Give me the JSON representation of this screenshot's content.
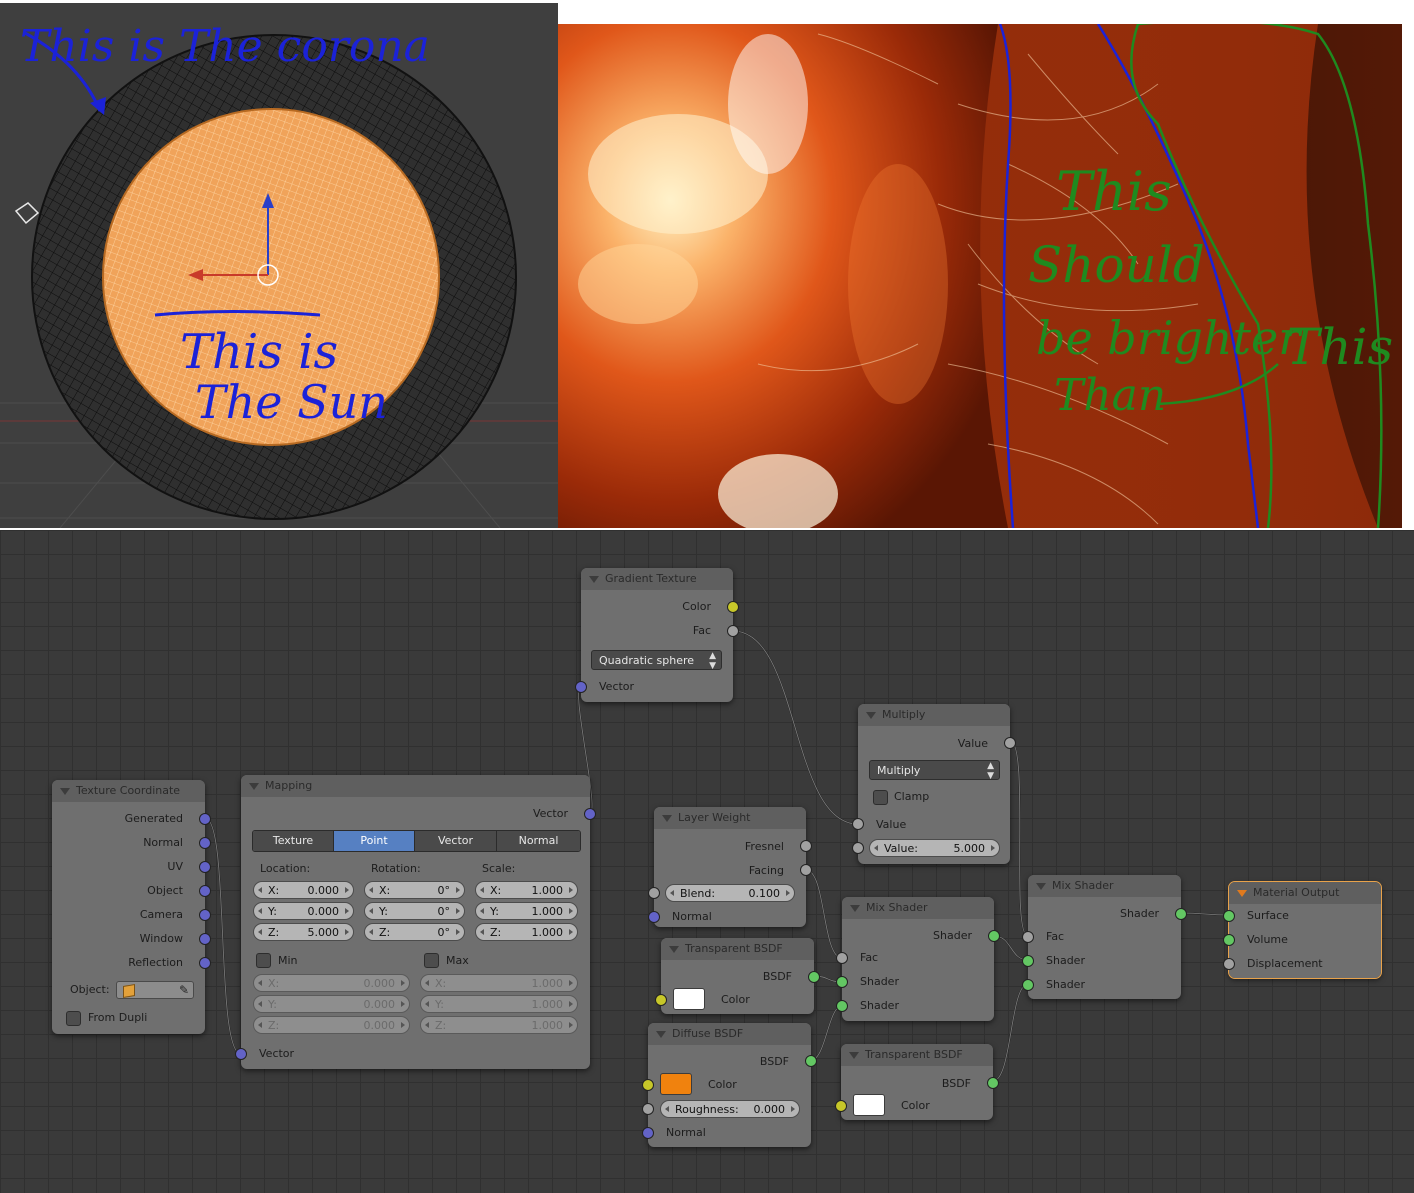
{
  "viewport": {
    "annotation_corona": "This is   The corona",
    "annotation_sun_line1": "This is",
    "annotation_sun_line2": "The Sun"
  },
  "render": {
    "annotation_line1": "This",
    "annotation_line2": "Should",
    "annotation_line3": "be brighter",
    "annotation_line4": "Than",
    "annotation_this": "This"
  },
  "nodes": {
    "texture_coordinate": {
      "title": "Texture Coordinate",
      "outputs": [
        "Generated",
        "Normal",
        "UV",
        "Object",
        "Camera",
        "Window",
        "Reflection"
      ],
      "object_label": "Object:",
      "from_dupli_label": "From Dupli"
    },
    "mapping": {
      "title": "Mapping",
      "output_vector": "Vector",
      "tabs": [
        "Texture",
        "Point",
        "Vector",
        "Normal"
      ],
      "active_tab": "Point",
      "location_label": "Location:",
      "rotation_label": "Rotation:",
      "scale_label": "Scale:",
      "location": [
        {
          "axis": "X:",
          "value": "0.000"
        },
        {
          "axis": "Y:",
          "value": "0.000"
        },
        {
          "axis": "Z:",
          "value": "5.000"
        }
      ],
      "rotation": [
        {
          "axis": "X:",
          "value": "0°"
        },
        {
          "axis": "Y:",
          "value": "0°"
        },
        {
          "axis": "Z:",
          "value": "0°"
        }
      ],
      "scale": [
        {
          "axis": "X:",
          "value": "1.000"
        },
        {
          "axis": "Y:",
          "value": "1.000"
        },
        {
          "axis": "Z:",
          "value": "1.000"
        }
      ],
      "min_label": "Min",
      "max_label": "Max",
      "min": [
        {
          "axis": "X:",
          "value": "0.000"
        },
        {
          "axis": "Y:",
          "value": "0.000"
        },
        {
          "axis": "Z:",
          "value": "0.000"
        }
      ],
      "max": [
        {
          "axis": "X:",
          "value": "1.000"
        },
        {
          "axis": "Y:",
          "value": "1.000"
        },
        {
          "axis": "Z:",
          "value": "1.000"
        }
      ],
      "input_vector": "Vector"
    },
    "gradient_texture": {
      "title": "Gradient Texture",
      "out_color": "Color",
      "out_fac": "Fac",
      "type": "Quadratic sphere",
      "input_vector": "Vector"
    },
    "multiply": {
      "title": "Multiply",
      "output_value": "Value",
      "operation": "Multiply",
      "clamp_label": "Clamp",
      "input_value": "Value",
      "value_label": "Value:",
      "value": "5.000"
    },
    "layer_weight": {
      "title": "Layer Weight",
      "out_fresnel": "Fresnel",
      "out_facing": "Facing",
      "blend_label": "Blend:",
      "blend": "0.100",
      "input_normal": "Normal"
    },
    "transparent_bsdf_1": {
      "title": "Transparent BSDF",
      "output": "BSDF",
      "color_label": "Color",
      "color": "#ffffff"
    },
    "diffuse_bsdf": {
      "title": "Diffuse BSDF",
      "output": "BSDF",
      "color_label": "Color",
      "color": "#f0820e",
      "roughness_label": "Roughness:",
      "roughness": "0.000",
      "input_normal": "Normal"
    },
    "mix_shader_1": {
      "title": "Mix Shader",
      "output": "Shader",
      "in_fac": "Fac",
      "in_shader_a": "Shader",
      "in_shader_b": "Shader"
    },
    "transparent_bsdf_2": {
      "title": "Transparent BSDF",
      "output": "BSDF",
      "color_label": "Color",
      "color": "#ffffff"
    },
    "mix_shader_2": {
      "title": "Mix Shader",
      "output": "Shader",
      "in_fac": "Fac",
      "in_shader_a": "Shader",
      "in_shader_b": "Shader"
    },
    "material_output": {
      "title": "Material Output",
      "in_surface": "Surface",
      "in_volume": "Volume",
      "in_displacement": "Displacement"
    }
  }
}
